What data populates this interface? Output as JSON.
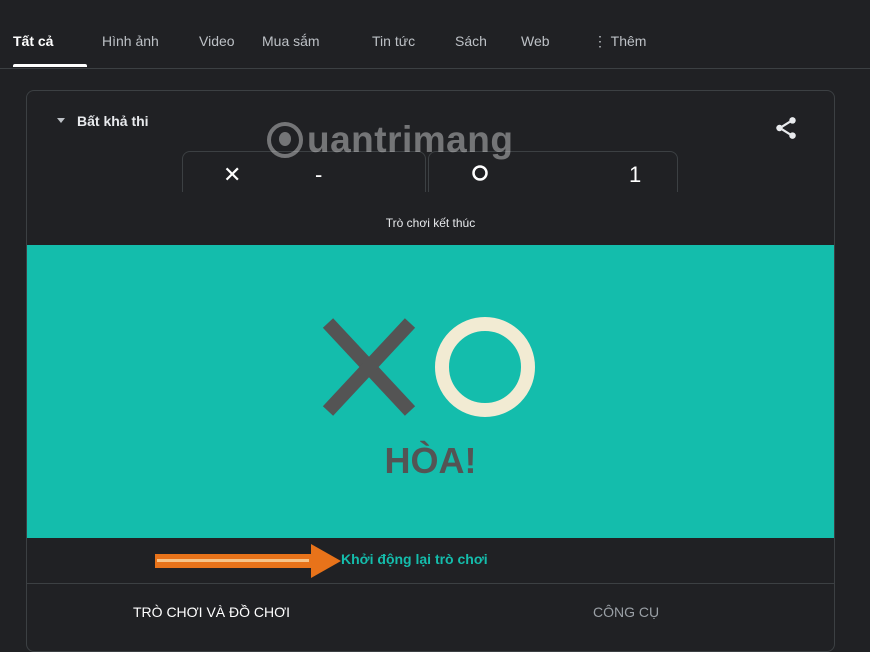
{
  "tabs": [
    {
      "label": "Tất cả",
      "active": true
    },
    {
      "label": "Hình ảnh"
    },
    {
      "label": "Video"
    },
    {
      "label": "Mua sắm"
    },
    {
      "label": "Tin tức"
    },
    {
      "label": "Sách"
    },
    {
      "label": "Web"
    },
    {
      "label": "⋮ Thêm"
    }
  ],
  "game": {
    "difficulty": "Bất khả thi",
    "x_symbol": "✕",
    "x_score": "-",
    "o_score": "1",
    "status": "Trò chơi kết thúc",
    "result": "HÒA!",
    "restart": "Khởi động lại trò chơi"
  },
  "watermark": "uantrimang",
  "bottom_tabs": [
    "TRÒ CHƠI VÀ ĐỒ CHƠI",
    "CÔNG CỤ"
  ],
  "colors": {
    "background": "#202124",
    "board": "#14bdac",
    "x_mark": "#545454",
    "o_mark": "#f2ebd3",
    "arrow": "#e8731a",
    "restart_text": "#14bdac"
  },
  "icons": [
    "share-icon",
    "caret-down-icon",
    "arrow-right-icon",
    "quantrimang-logo"
  ]
}
